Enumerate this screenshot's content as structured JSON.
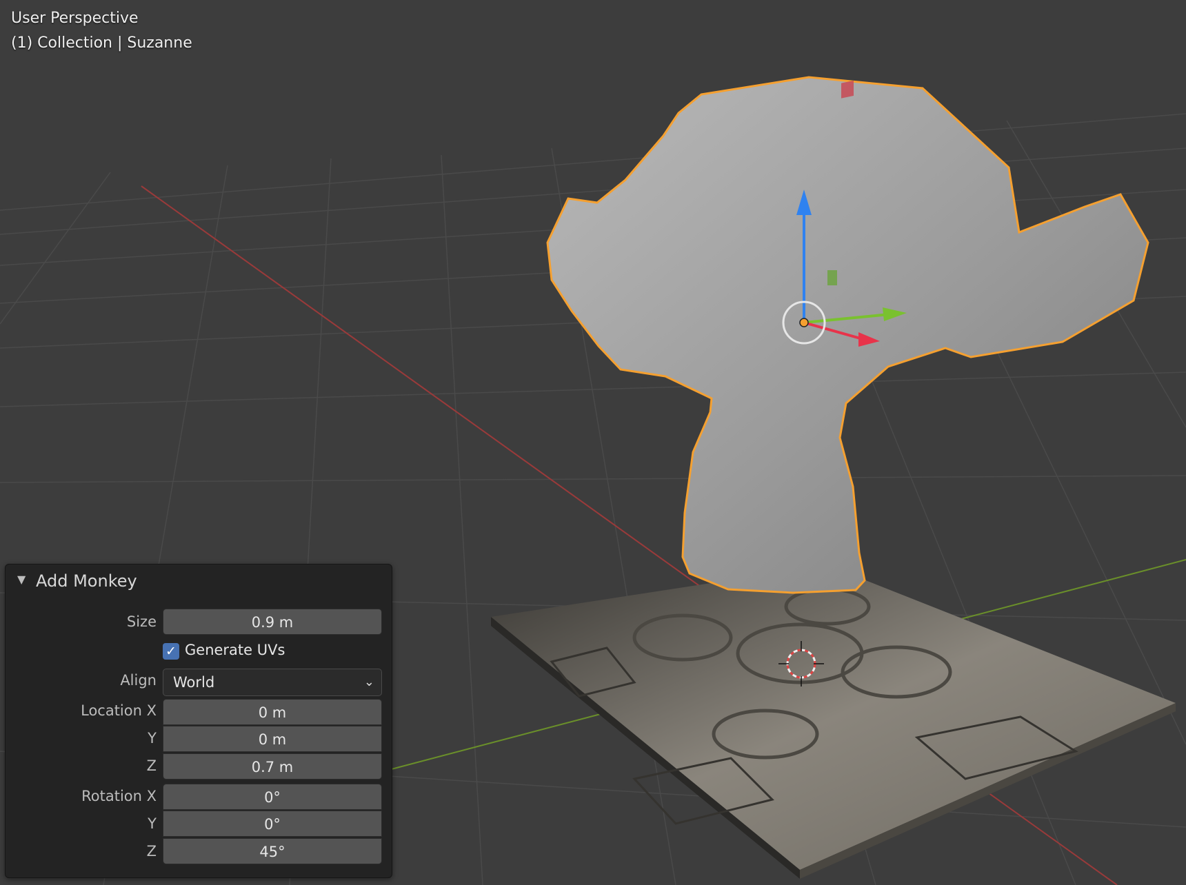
{
  "viewport": {
    "title": "User Perspective",
    "subtitle": "(1) Collection | Suzanne",
    "colors": {
      "background": "#3d3d3d",
      "grid": "#4a4a4a",
      "x_axis": "#9a3a3a",
      "y_axis": "#6a8f2a",
      "selection_outline": "#f5a030",
      "gizmo_z": "#2f82f0",
      "gizmo_y": "#7ac12f",
      "gizmo_x": "#e8334a"
    }
  },
  "operator_panel": {
    "title": "Add Monkey",
    "size_label": "Size",
    "size_value": "0.9 m",
    "generate_uvs_label": "Generate UVs",
    "generate_uvs_checked": true,
    "align_label": "Align",
    "align_value": "World",
    "location_label": "Location X",
    "location_x": "0 m",
    "location_y_label": "Y",
    "location_y": "0 m",
    "location_z_label": "Z",
    "location_z": "0.7 m",
    "rotation_label": "Rotation X",
    "rotation_x": "0°",
    "rotation_y_label": "Y",
    "rotation_y": "0°",
    "rotation_z_label": "Z",
    "rotation_z": "45°"
  }
}
